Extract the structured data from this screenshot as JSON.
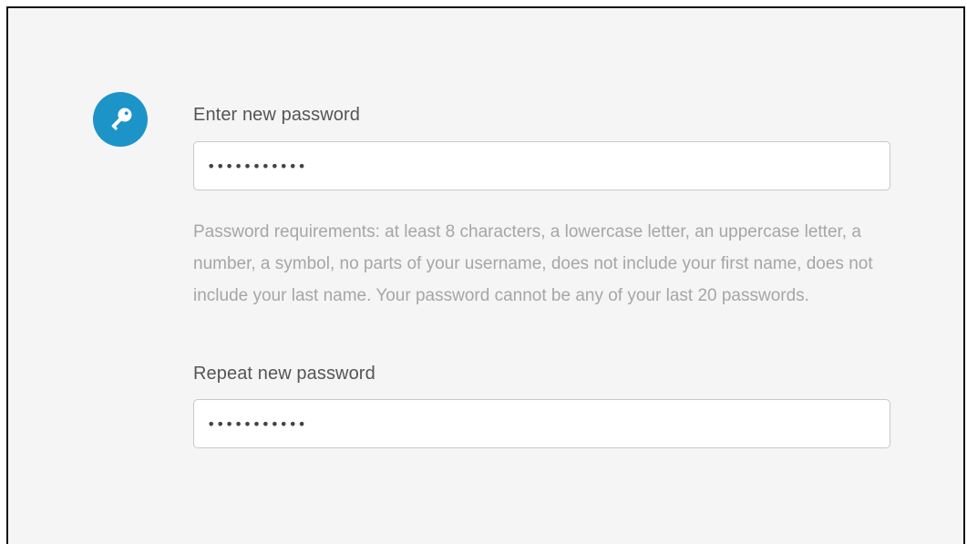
{
  "form": {
    "new_password_label": "Enter new password",
    "new_password_value": "•••••••••••",
    "requirements_text": "Password requirements: at least 8 characters, a lowercase letter, an uppercase letter, a number, a symbol, no parts of your username, does not include your first name, does not include your last name. Your password cannot be any of your last 20 passwords.",
    "repeat_password_label": "Repeat new password",
    "repeat_password_value": "•••••••••••"
  },
  "icons": {
    "badge": "key-icon"
  },
  "colors": {
    "accent": "#1c94c8",
    "background": "#f5f5f5",
    "label_text": "#555555",
    "hint_text": "#a6a6a6"
  }
}
